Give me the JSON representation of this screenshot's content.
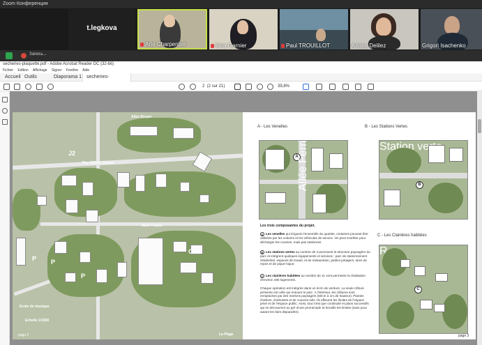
{
  "zoom": {
    "title": "Zoom Конференция",
    "user_tile": "t.legkova",
    "participants": [
      {
        "name": "Arte Charpentier"
      },
      {
        "name": "Irina Garnier"
      },
      {
        "name": "Paul TROUILLOT"
      },
      {
        "name": "Ariane Delilez"
      },
      {
        "name": "Grigori Isachenko"
      }
    ],
    "share_label": "Запись..."
  },
  "acrobat": {
    "window_title": "secheries-plaquette.pdf - Adobe Acrobat Reader DC (32-bit)",
    "menu": [
      "Fichier",
      "Edition",
      "Affichage",
      "Signer",
      "Fenêtre",
      "Aide"
    ],
    "tabs": [
      "Accueil",
      "Outils",
      "Diaporama 1",
      "secheries-plaquette..."
    ],
    "page_current": "2",
    "page_total": "(2 sur 21)",
    "zoom": "39,8%"
  },
  "document": {
    "left_page_num": "page 2",
    "right_page_num": "page 3",
    "plan_labels": {
      "j2": "J2",
      "p1": "P",
      "p2": "P",
      "p3": "P",
      "o": "O",
      "street_top": "Allée Bruyer",
      "street_mid": "Rue Gilbert Cézard",
      "street_low": "Allée France",
      "school": "Ecole de musique",
      "scale": "Echelle 1/1500",
      "plage": "La Plage"
    },
    "sections": {
      "a": "A - Les Venelles",
      "b": "B - Les Stations Vertes",
      "c": "C - Les Clairières habitées"
    },
    "thumb_labels": {
      "a": "A",
      "a_street": "Allée Ferrie",
      "b": "B",
      "b_station": "Station verte",
      "c": "C",
      "c_r": "R"
    },
    "heading": "Les trois composantes du projet.",
    "items": [
      {
        "letter": "A",
        "bold": "Les venelles",
        "text": " qui irriguent l'ensemble du quartier, certaines pouvant être utilisées par les voitures et les véhicules de service. On peut s'arrêter pour décharger les courses, mais pas stationner."
      },
      {
        "letter": "B",
        "bold": "Les stations vertes",
        "text": " au nombre de 3 ponctuent la structure paysagère du parc et intègrent quelques équipements et services : parc de stationnement résidentiel, espaces de travail, et de restauration, jardins potagers, aires de repos et de pique-nique."
      },
      {
        "letter": "C",
        "bold": "Les clairières habitées",
        "text": " au nombre de 11 vont permettre la réalisation d'environ 480 logements."
      }
    ],
    "paragraph": "Chaque opération est intégrée dans un écrin de verdure. La seule clôture présente est celle qui entoure le parc. A l'intérieur, les clôtures sont remplacées par des merlons paysagers (50cm à 1m de hauteur). Plantes d'arbres, d'arbustes et de couvres-sols. Ils effacent les limites de l'espace privé et de l'espace public. Ainsi, tout n'est que continuité et plans successifs qui se découvrent au gré d'une promenade et brouille les limites (sans pour autant les faire disparaître)."
  }
}
